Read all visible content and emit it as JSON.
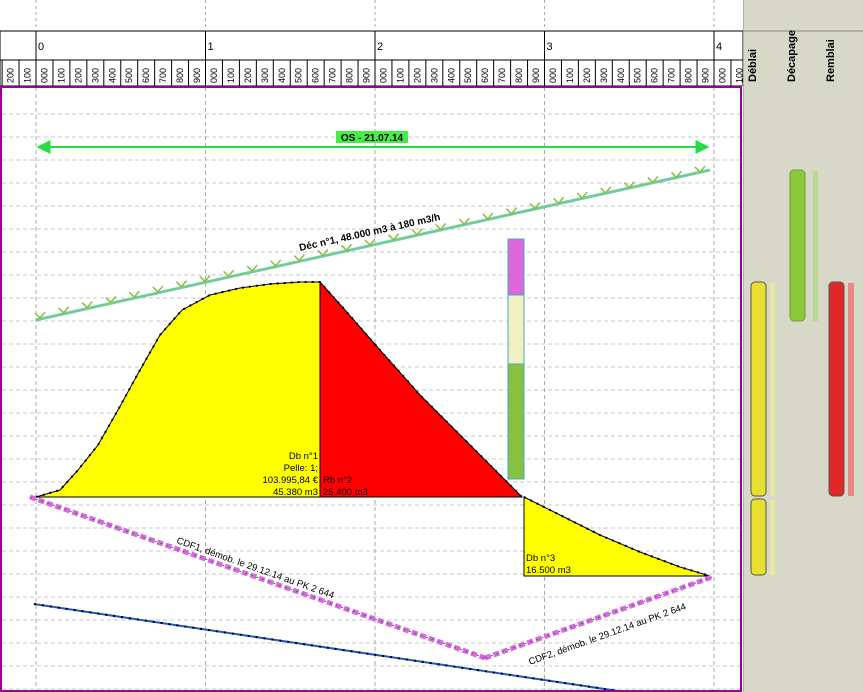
{
  "ruler": {
    "major_labels": [
      "0",
      "1",
      "2",
      "3",
      "4"
    ],
    "minor_labels": [
      "200",
      "100",
      "000",
      "100",
      "200",
      "300",
      "400",
      "500",
      "600",
      "700",
      "800",
      "900",
      "000",
      "100",
      "200",
      "300",
      "400",
      "500",
      "600",
      "700",
      "800",
      "900",
      "000",
      "100",
      "200",
      "300",
      "400",
      "500",
      "600",
      "700",
      "800",
      "900",
      "000",
      "100",
      "200",
      "300",
      "400",
      "500",
      "600",
      "700",
      "800",
      "900",
      "000",
      "100"
    ]
  },
  "os_marker": {
    "label": "OS - 21.07.14",
    "color": "#22dd44"
  },
  "decapage_label": "Déc n°1, 48.000 m3 à 180 m3/h",
  "blocks": {
    "db1": {
      "lines": [
        "Db n°1",
        "Pelle: 1;",
        "103.995,84 €",
        "45.380 m3"
      ],
      "color": "#ffff00"
    },
    "rb2": {
      "lines": [
        "Rb n°2",
        "25.400 m3"
      ],
      "color": "#ff0000"
    },
    "db3": {
      "lines": [
        "Db n°3",
        "16.500 m3"
      ],
      "color": "#ffff00"
    }
  },
  "cdf1_label": "CDF1, démob. le 29.12.14 au PK 2 644",
  "cdf2_label": "CDF2, démob. le 29.12.14 au PK 2 644",
  "columns": [
    {
      "label": "Déblai",
      "color": "#e8e030"
    },
    {
      "label": "Décapage",
      "color": "#8cc83c"
    },
    {
      "label": "Remblai",
      "color": "#e02828"
    }
  ],
  "colors": {
    "frame": "#990099",
    "grid": "#bbbbbb",
    "ruler_border": "#000000",
    "stack_pink": "#dd66dd",
    "stack_cream": "#f0f0c0",
    "stack_green": "#88c040",
    "cyan": "#66cccc"
  }
}
